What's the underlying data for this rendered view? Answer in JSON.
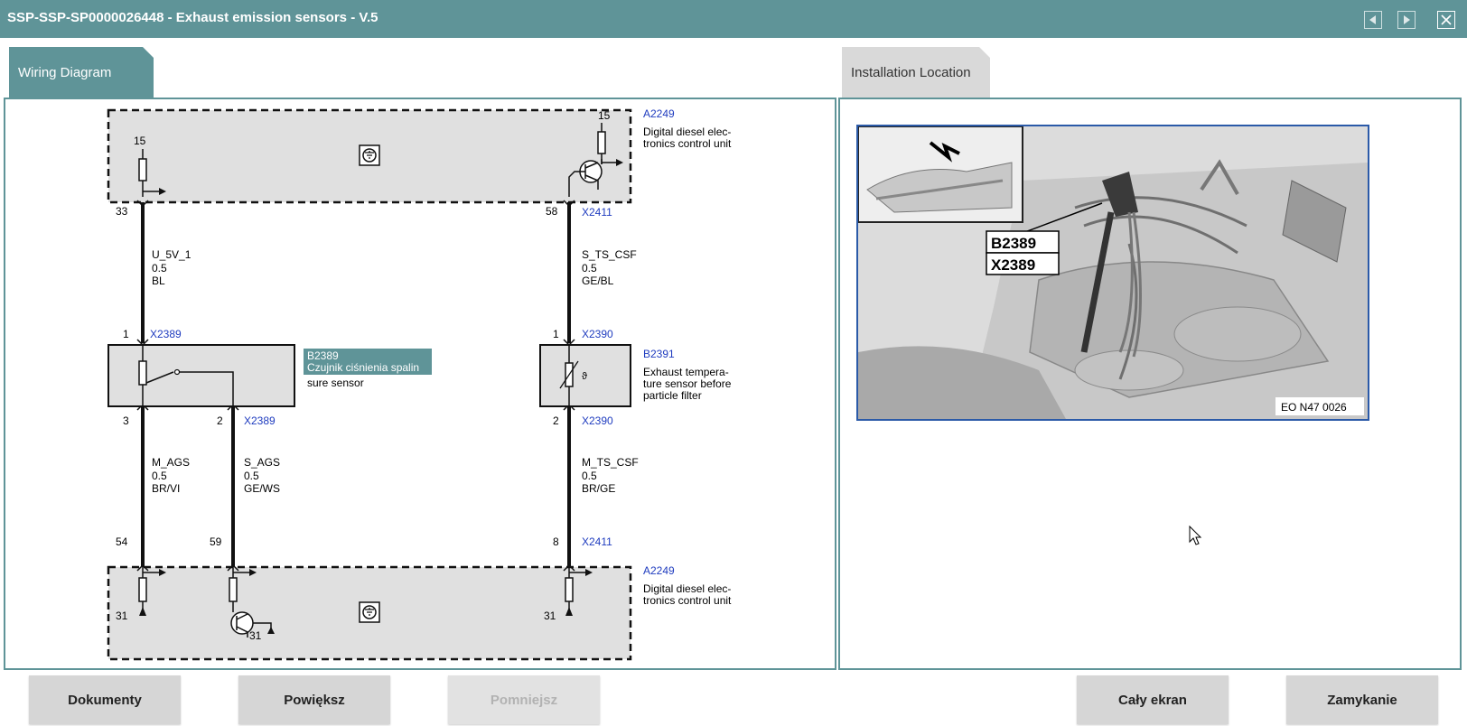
{
  "window": {
    "title": "SSP-SSP-SP0000026448 - Exhaust emission sensors - V.5"
  },
  "tabs": {
    "wiring": "Wiring Diagram",
    "installation": "Installation Location"
  },
  "diagram": {
    "top_unit": {
      "id": "A2249",
      "desc1": "Digital diesel elec-",
      "desc2": "tronics control unit",
      "pin15a": "15",
      "pin15b": "15"
    },
    "bottom_unit": {
      "id": "A2249",
      "desc1": "Digital diesel elec-",
      "desc2": "tronics control unit",
      "gnd1": "31",
      "gnd2": "31",
      "gnd3": "31"
    },
    "left_sensor": {
      "id": "B2389",
      "name": "Czujnik ciśnienia spalin",
      "extra": "sure sensor"
    },
    "right_sensor": {
      "id": "B2391",
      "desc1": "Exhaust tempera-",
      "desc2": "ture sensor before",
      "desc3": "particle filter"
    },
    "pins": {
      "p33": "33",
      "p58": "58",
      "p1a": "1",
      "p1b": "1",
      "p3": "3",
      "p2a": "2",
      "p2b": "2",
      "p54": "54",
      "p59": "59",
      "p8": "8"
    },
    "connectors": {
      "x2411_top": "X2411",
      "x2389_top": "X2389",
      "x2390_top": "X2390",
      "x2389_bottom": "X2389",
      "x2390_bottom": "X2390",
      "x2411_bottom": "X2411"
    },
    "wires": {
      "w1": {
        "name": "U_5V_1",
        "size": "0.5",
        "color": "BL"
      },
      "w2": {
        "name": "S_TS_CSF",
        "size": "0.5",
        "color": "GE/BL"
      },
      "w3": {
        "name": "M_AGS",
        "size": "0.5",
        "color": "BR/VI"
      },
      "w4": {
        "name": "S_AGS",
        "size": "0.5",
        "color": "GE/WS"
      },
      "w5": {
        "name": "M_TS_CSF",
        "size": "0.5",
        "color": "BR/GE"
      }
    }
  },
  "photo": {
    "label1": "B2389",
    "label2": "X2389",
    "caption": "EO N47 0026"
  },
  "buttons": {
    "documents": "Dokumenty",
    "zoom_in": "Powiększ",
    "zoom_out": "Pomniejsz",
    "fullscreen": "Cały ekran",
    "close": "Zamykanie"
  },
  "colors": {
    "accent": "#5f9498",
    "link": "#1f3cbf",
    "highlight": "#5f9498"
  }
}
